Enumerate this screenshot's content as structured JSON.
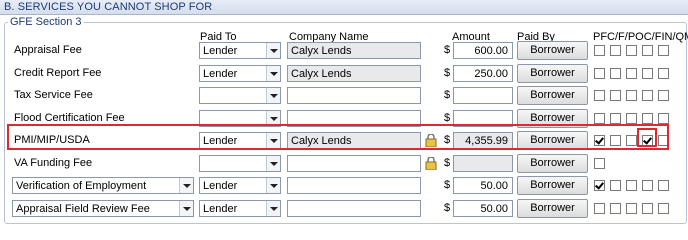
{
  "section_title": "B. SERVICES YOU CANNOT SHOP FOR",
  "group_title": "GFE Section 3",
  "headers": {
    "paid_to": "Paid To",
    "company_name": "Company Name",
    "amount": "Amount",
    "paid_by": "Paid By",
    "flags": "PFC/F/POC/FIN/QM"
  },
  "currency_symbol": "$",
  "rows": [
    {
      "label": "Appraisal Fee",
      "label_is_combo": false,
      "paid_to": "Lender",
      "company": "Calyx Lends",
      "company_readonly": true,
      "show_lock": false,
      "amount": "600.00",
      "amount_readonly": false,
      "paid_by": "Borrower",
      "flags": [
        false,
        false,
        false,
        false,
        false
      ]
    },
    {
      "label": "Credit Report Fee",
      "label_is_combo": false,
      "paid_to": "Lender",
      "company": "Calyx Lends",
      "company_readonly": true,
      "show_lock": false,
      "amount": "250.00",
      "amount_readonly": false,
      "paid_by": "Borrower",
      "flags": [
        false,
        false,
        false,
        false,
        false
      ]
    },
    {
      "label": "Tax Service Fee",
      "label_is_combo": false,
      "paid_to": "",
      "company": "",
      "company_readonly": false,
      "show_lock": false,
      "amount": "",
      "amount_readonly": false,
      "paid_by": "Borrower",
      "flags": [
        false,
        false,
        false,
        false,
        false
      ]
    },
    {
      "label": "Flood Certification Fee",
      "label_is_combo": false,
      "paid_to": "",
      "company": "",
      "company_readonly": false,
      "show_lock": false,
      "amount": "",
      "amount_readonly": false,
      "paid_by": "Borrower",
      "flags": [
        false,
        false,
        false,
        false,
        false
      ]
    },
    {
      "label": "PMI/MIP/USDA",
      "label_is_combo": false,
      "paid_to": "Lender",
      "company": "Calyx Lends",
      "company_readonly": true,
      "show_lock": true,
      "amount": "4,355.99",
      "amount_readonly": true,
      "paid_by": "Borrower",
      "flags": [
        true,
        false,
        false,
        true,
        false
      ]
    },
    {
      "label": "VA Funding Fee",
      "label_is_combo": false,
      "paid_to": "",
      "company": "",
      "company_readonly": false,
      "show_lock": true,
      "amount": "",
      "amount_readonly": true,
      "paid_by": "Borrower",
      "flags": [
        false,
        null,
        null,
        null,
        null
      ]
    },
    {
      "label": "Verification of Employment",
      "label_is_combo": true,
      "paid_to": "Lender",
      "company": "",
      "company_readonly": false,
      "show_lock": false,
      "amount": "50.00",
      "amount_readonly": false,
      "paid_by": "Borrower",
      "flags": [
        true,
        false,
        false,
        false,
        false
      ]
    },
    {
      "label": "Appraisal Field Review Fee",
      "label_is_combo": true,
      "paid_to": "Lender",
      "company": "",
      "company_readonly": false,
      "show_lock": false,
      "amount": "50.00",
      "amount_readonly": false,
      "paid_by": "Borrower",
      "flags": [
        false,
        false,
        false,
        false,
        false
      ]
    }
  ]
}
